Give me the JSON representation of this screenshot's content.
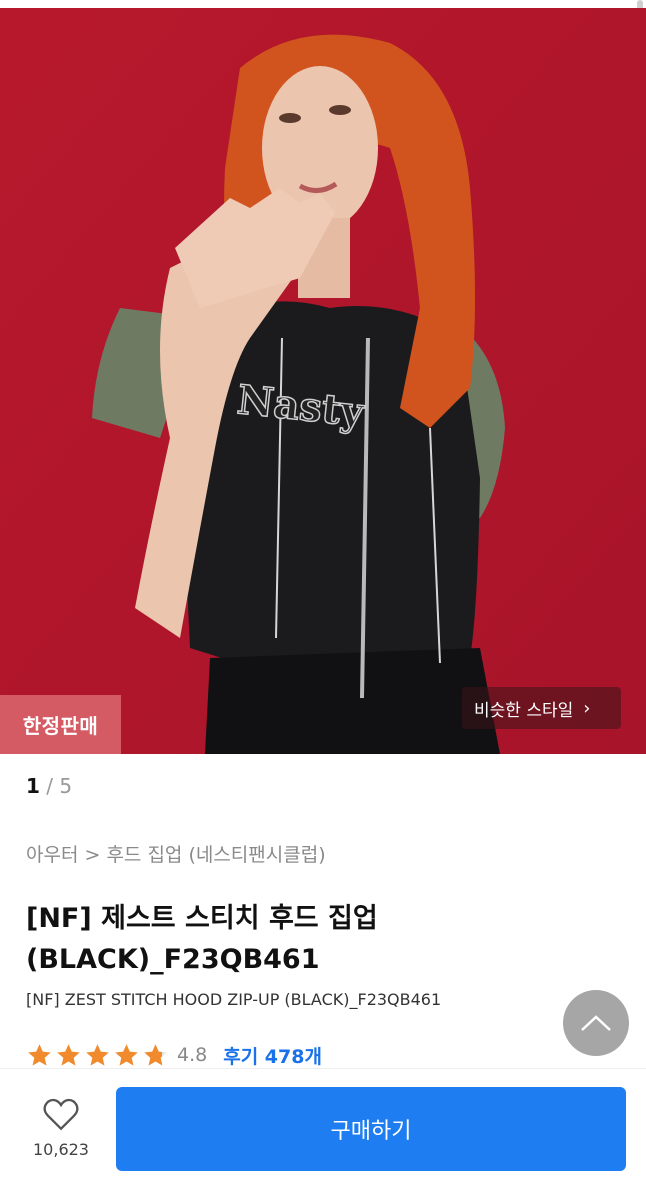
{
  "hero": {
    "badge": "한정판매",
    "similar_style": "비슷한 스타일",
    "shirt_lettering": "Nasty"
  },
  "pager": {
    "current": "1",
    "separator": " / ",
    "total": "5"
  },
  "breadcrumb": "아우터 > 후드 집업 (네스티팬시클럽)",
  "product": {
    "title": "[NF] 제스트 스티치 후드 집업 (BLACK)_F23QB461",
    "subtitle": "[NF] ZEST STITCH HOOD ZIP-UP (BLACK)_F23QB461"
  },
  "rating": {
    "score": "4.8",
    "stars": 4.8,
    "reviews": "후기 478개"
  },
  "bottom": {
    "like_count": "10,623",
    "buy_label": "구매하기"
  },
  "colors": {
    "accent": "#1e7df0",
    "star": "#f08a2c",
    "hero_bg": "#b5172b",
    "badge": "#d45a64"
  },
  "icons": [
    "heart-icon",
    "chevron-right-icon",
    "arrow-up-icon",
    "star-icon"
  ]
}
